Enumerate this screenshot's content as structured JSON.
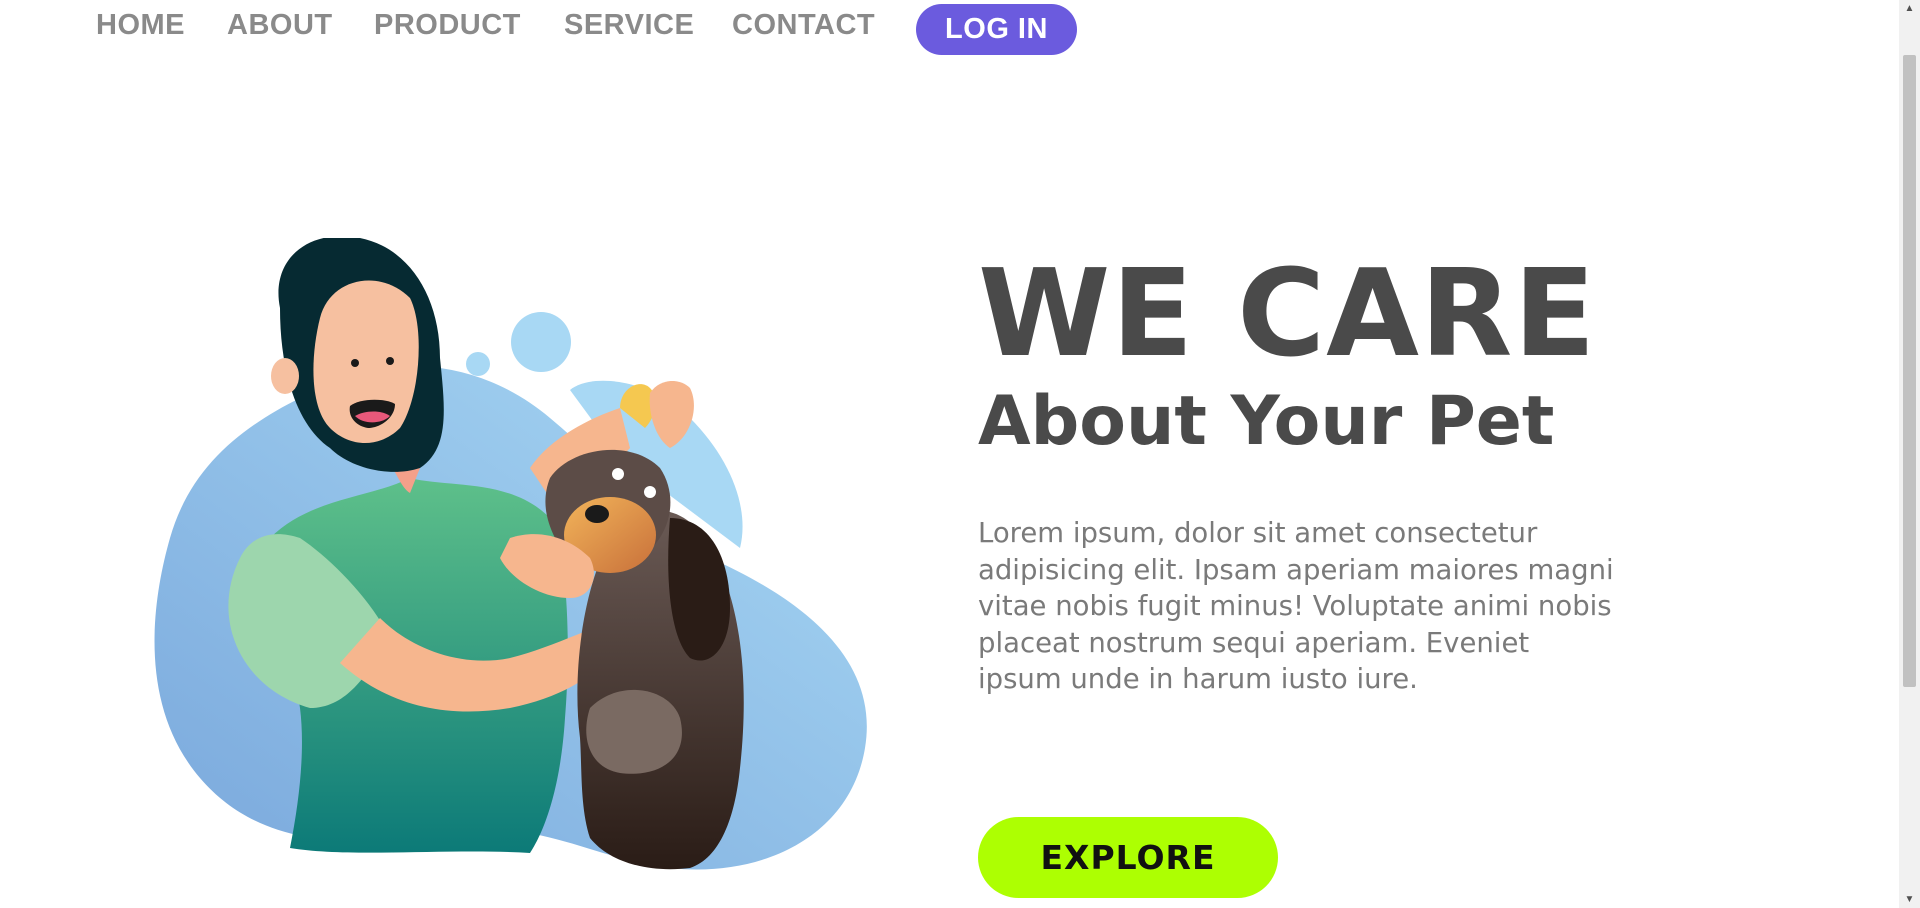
{
  "nav": {
    "items": [
      {
        "label": "HOME"
      },
      {
        "label": "ABOUT"
      },
      {
        "label": "PRODUCT"
      },
      {
        "label": "SERVICE"
      },
      {
        "label": "CONTACT"
      }
    ],
    "login_label": "LOG IN"
  },
  "hero": {
    "title": "WE CARE",
    "subtitle": "About Your Pet",
    "body": "Lorem ipsum, dolor sit amet consectetur adipisicing elit. Ipsam aperiam maiores magni vitae nobis fugit minus! Voluptate animi nobis placeat nostrum sequi aperiam. Eveniet ipsum unde in harum iusto iure.",
    "cta_label": "EXPLORE"
  },
  "colors": {
    "accent": "#6b5bde",
    "cta": "#adff02",
    "heading": "#4a4a4a",
    "nav_text": "#8a8a8a"
  },
  "icons": {
    "illustration": "woman-giving-eye-drops-to-dog",
    "scroll_up": "arrow-up-icon",
    "scroll_down": "arrow-down-icon"
  }
}
